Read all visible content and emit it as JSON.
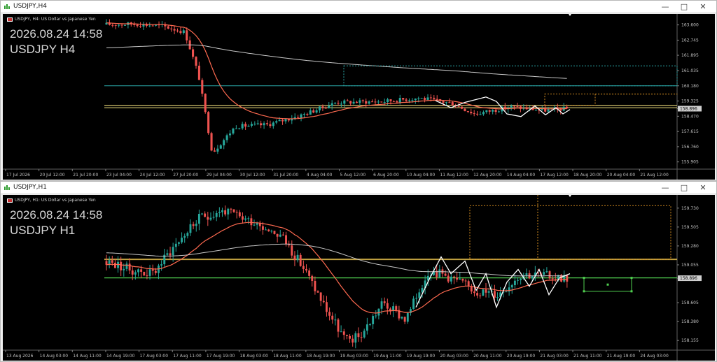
{
  "window1": {
    "title": "USDJPY,H4",
    "symbol_desc": "USDJPY, H4:  US Dollar vs Japanese Yen",
    "overlay_date": "2026.08.24 14:58",
    "overlay_tf": "USDJPY H4",
    "price_labels": [
      "163.600",
      "162.745",
      "161.895",
      "161.035",
      "160.180",
      "159.325",
      "158.896",
      "158.470",
      "157.615",
      "156.760",
      "155.905"
    ],
    "time_labels": [
      "17 Jul 2026",
      "20 Jul 12:00",
      "21 Jul 20:00",
      "23 Jul 04:00",
      "24 Jul 12:00",
      "27 Jul 20:00",
      "29 Jul 04:00",
      "30 Jul 12:00",
      "31 Jul 20:00",
      "4 Aug 04:00",
      "5 Aug 12:00",
      "6 Aug 20:00",
      "10 Aug 04:00",
      "11 Aug 12:00",
      "12 Aug 20:00",
      "14 Aug 04:00",
      "17 Aug 12:00",
      "18 Aug 20:00",
      "20 Aug 04:00",
      "21 Aug 12:00"
    ],
    "ymax": 163.9,
    "ymin": 155.5
  },
  "window2": {
    "title": "USDJPY,H1",
    "symbol_desc": "USDJPY, H1:  US Dollar vs Japanese Yen",
    "overlay_date": "2026.08.24 14:58",
    "overlay_tf": "USDJPY H1",
    "price_labels": [
      "159.730",
      "159.505",
      "159.280",
      "159.055",
      "158.896",
      "158.605",
      "158.380",
      "158.155"
    ],
    "time_labels": [
      "13 Aug 2026",
      "14 Aug 03:00",
      "14 Aug 11:00",
      "14 Aug 19:00",
      "17 Aug 03:00",
      "17 Aug 11:00",
      "17 Aug 19:00",
      "18 Aug 03:00",
      "18 Aug 11:00",
      "18 Aug 19:00",
      "19 Aug 03:00",
      "19 Aug 11:00",
      "19 Aug 19:00",
      "20 Aug 03:00",
      "20 Aug 11:00",
      "20 Aug 19:00",
      "21 Aug 03:00",
      "21 Aug 11:00",
      "21 Aug 19:00",
      "24 Aug 03:00"
    ],
    "ymax": 159.82,
    "ymin": 158.04
  },
  "colors": {
    "bull": "#26a69a",
    "bear": "#ef5350",
    "ema": "#ff6a50",
    "sma": "#c8c8c8",
    "hline_cyan": "#2aa8a8",
    "hline_yellow": "#e8d878",
    "hline_green": "#50d050",
    "dotted_orange": "#d08a20",
    "zigzag": "#ffffff"
  }
}
